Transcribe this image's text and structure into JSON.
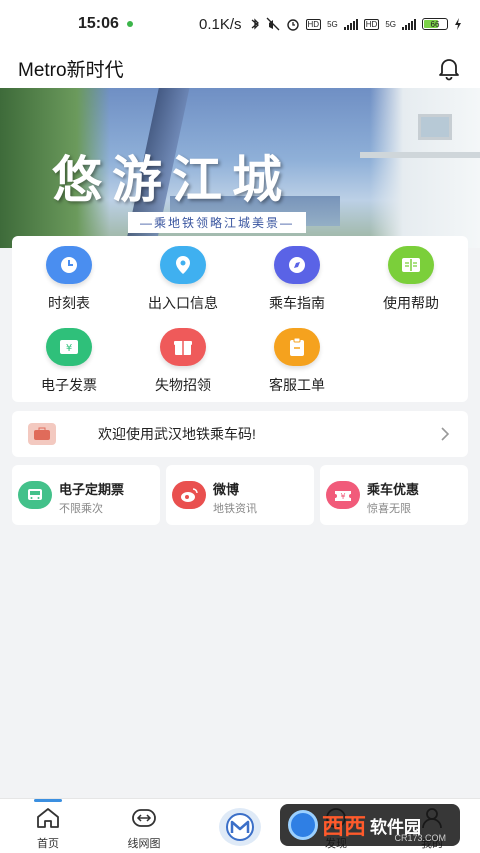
{
  "status_bar": {
    "time": "15:06",
    "network_speed": "0.1K/s",
    "hd1": "HD",
    "sig1": "5G",
    "hd2": "HD",
    "sig2": "5G",
    "battery": "66"
  },
  "app_bar": {
    "title": "Metro新时代"
  },
  "banner": {
    "headline": "悠游江城",
    "subtitle": "—乘地铁领略江城美景—"
  },
  "grid": [
    {
      "label": "时刻表",
      "color": "#4a8ef0"
    },
    {
      "label": "出入口信息",
      "color": "#3fb0f0"
    },
    {
      "label": "乘车指南",
      "color": "#5a63e6"
    },
    {
      "label": "使用帮助",
      "color": "#7bcf3a"
    },
    {
      "label": "电子发票",
      "color": "#2fc07a"
    },
    {
      "label": "失物招领",
      "color": "#ef5a5a"
    },
    {
      "label": "客服工单",
      "color": "#f5a21e"
    }
  ],
  "notice": {
    "text": "欢迎使用武汉地铁乘车码!"
  },
  "cards": [
    {
      "title": "电子定期票",
      "subtitle": "不限乘次",
      "color": "#43c18a"
    },
    {
      "title": "微博",
      "subtitle": "地铁资讯",
      "color": "#e9504f"
    },
    {
      "title": "乘车优惠",
      "subtitle": "惊喜无限",
      "color": "#f15b7a"
    }
  ],
  "tabs": {
    "home": "首页",
    "lines": "线网图",
    "discover": "发现",
    "mine": "我的"
  },
  "watermark": {
    "brand": "西西",
    "name": "软件园",
    "domain": "CR173.COM"
  }
}
